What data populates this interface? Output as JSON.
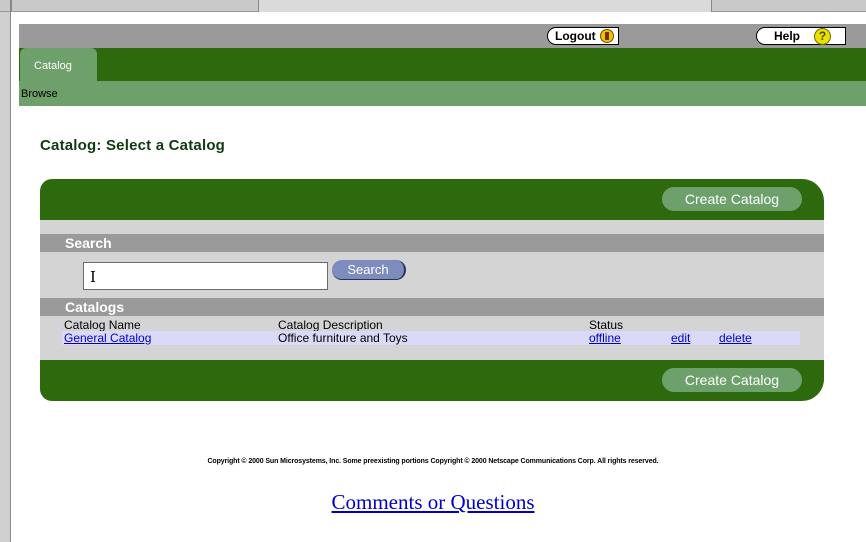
{
  "header": {
    "logout_label": "Logout",
    "help_label": "Help",
    "help_glyph": "?"
  },
  "nav": {
    "tab_label": "Catalog",
    "sub_label": "Browse"
  },
  "page": {
    "title": "Catalog: Select a Catalog"
  },
  "panel": {
    "create_label": "Create Catalog",
    "search_heading": "Search",
    "search_value": "I",
    "search_button": "Search",
    "catalogs_heading": "Catalogs",
    "columns": {
      "name": "Catalog Name",
      "description": "Catalog Description",
      "status": "Status"
    },
    "rows": [
      {
        "name": "General Catalog",
        "description": "Office furniture and Toys",
        "status": "offline",
        "edit": "edit",
        "delete": "delete"
      }
    ]
  },
  "footer": {
    "copyright": "Copyright © 2000 Sun Microsystems, Inc. Some preexisting portions Copyright © 2000 Netscape Communications Corp. All rights reserved.",
    "comments_link": "Comments or Questions"
  },
  "colors": {
    "dark_green": "#2d6a0e",
    "light_green": "#6da06a",
    "gray_bar": "#9a9a9a",
    "panel_bg": "#d4d4d4",
    "row_highlight": "#dadaf8",
    "link_blue": "#0000cc"
  }
}
